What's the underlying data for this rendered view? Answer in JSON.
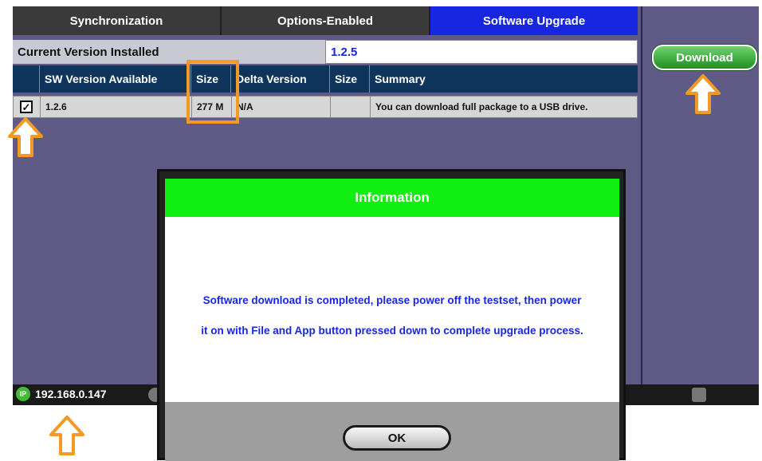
{
  "tabs": [
    {
      "label": "Synchronization",
      "active": false
    },
    {
      "label": "Options-Enabled",
      "active": false
    },
    {
      "label": "Software Upgrade",
      "active": true
    }
  ],
  "current_version": {
    "label": "Current Version Installed",
    "value": "1.2.5"
  },
  "download_button": {
    "label": "Download"
  },
  "table": {
    "headers": [
      "",
      "SW Version Available",
      "Size",
      "Delta Version",
      "Size",
      "Summary"
    ],
    "rows": [
      {
        "checked": true,
        "check_glyph": "✓",
        "sw_version": "1.2.6",
        "size": "277 M",
        "delta_version": "N/A",
        "delta_size": "",
        "summary": "You can download full package to a USB drive."
      }
    ]
  },
  "status_bar": {
    "ip_icon_label": "IP",
    "ip_address": "192.168.0.147"
  },
  "dialog": {
    "title": "Information",
    "line1": "Software download is completed, please power off the testset, then power",
    "line2": "it on with File and App button pressed down to complete upgrade process.",
    "ok_label": "OK"
  },
  "colors": {
    "active_tab": "#1726e0",
    "dialog_title_bg": "#11ee11",
    "annotation": "#f29a21",
    "download_button": "#2fa833"
  },
  "icons": [
    "up-arrow-annotation-icon",
    "ip-status-icon",
    "checkbox-checked-icon"
  ]
}
